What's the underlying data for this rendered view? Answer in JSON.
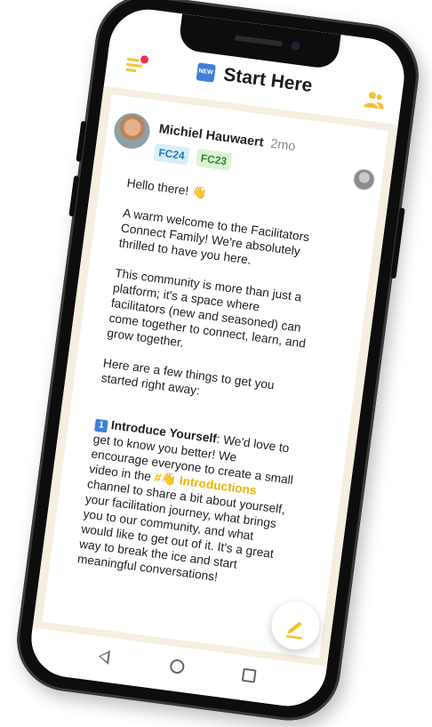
{
  "header": {
    "badge_text": "NEW",
    "title": "Start Here",
    "menu_icon": "hamburger-notification-icon",
    "people_icon": "members-icon",
    "accent_color": "#f2c230"
  },
  "post": {
    "author": "Michiel Hauwaert",
    "time": "2mo",
    "tags": [
      "FC24",
      "FC23"
    ],
    "greeting": "Hello there! 👋",
    "paragraphs": [
      "A warm welcome to the Facilitators Connect Family! We're absolutely thrilled to have you here.",
      "This community is more than just a platform; it's a space where facilitators (new and seasoned) can come together to connect, learn, and grow together.",
      "Here are a few things to get you started right away:"
    ],
    "item1": {
      "number": "1",
      "title": "Introduce Yourself",
      "text_before": ": We'd love to get to know you better! We encourage everyone to create a small video in the ",
      "channel": "#👋 Introductions",
      "text_after": " channel to share a bit about yourself, your facilitation journey, what brings you to our community, and what would like to get out of it. It's a great way to break the ice and start meaningful conversations!"
    }
  },
  "fab_icon": "compose-pencil-icon",
  "navbar_icons": [
    "back-icon",
    "home-icon",
    "recent-apps-icon"
  ]
}
